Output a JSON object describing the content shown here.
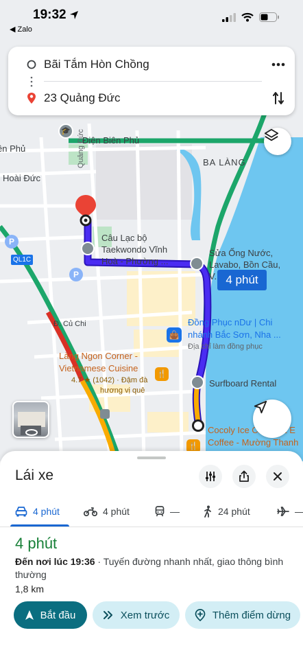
{
  "status_bar": {
    "time": "19:32",
    "back_app": "Zalo"
  },
  "directions": {
    "origin": "Bãi Tắm Hòn Chồng",
    "destination": "23 Quảng Đức"
  },
  "map": {
    "labels": {
      "dien_bien_phu": "Điện Biên Phủ",
      "bien_phu": "ên Phủ",
      "hoai_duc": "Hoài Đức",
      "quang_duc": "Quảng Đức",
      "ba_lang": "BA LÀNG",
      "club_1": "Câu Lạc bộ",
      "club_2": "Taekwondo Vĩnh",
      "club_3": "Hoà - Phường ...",
      "repair_1": "Sửa Ống Nước,",
      "repair_2": "Lavabo, Bồn Cầu,",
      "repair_3": "V...",
      "uniform_1": "Đồng Phục nDư | Chi",
      "uniform_2": "nhánh Bắc Sơn, Nha ...",
      "uniform_3": "Địa chỉ làm đồng phục",
      "cu_chi": "Đ. Củ Chi",
      "lang_1": "Làng Ngon Corner -",
      "lang_2": "Vietnamese Cuisine",
      "lang_rating": "4.7 ★ (1042) · Đậm đà",
      "lang_note": "hương vị quê",
      "surfboard": "Surfboard Rental",
      "cocoly_1": "Cocoly Ice Cream & E",
      "cocoly_2": "Coffee - Mường Thanh",
      "ql1c": "QL1C"
    },
    "route_badge": "4 phút"
  },
  "sheet": {
    "title": "Lái xe",
    "modes": [
      {
        "name": "car",
        "label": "4 phút"
      },
      {
        "name": "motorbike",
        "label": "4 phút"
      },
      {
        "name": "transit",
        "label": "—"
      },
      {
        "name": "walk",
        "label": "24 phút"
      },
      {
        "name": "flight",
        "label": "—"
      }
    ],
    "duration": "4 phút",
    "arrival_strong": "Đến nơi lúc 19:36",
    "arrival_note": " · Tuyến đường nhanh nhất, giao thông bình thường",
    "distance": "1,8 km",
    "actions": {
      "start": "Bắt đầu",
      "preview": "Xem trước",
      "add_stop": "Thêm điểm dừng"
    }
  },
  "colors": {
    "route": "#3c1de6",
    "accent": "#1967d2",
    "primary_button": "#0b6e80",
    "water": "#6ec6f0",
    "highway": "#1ca66a",
    "duration": "#188038"
  }
}
